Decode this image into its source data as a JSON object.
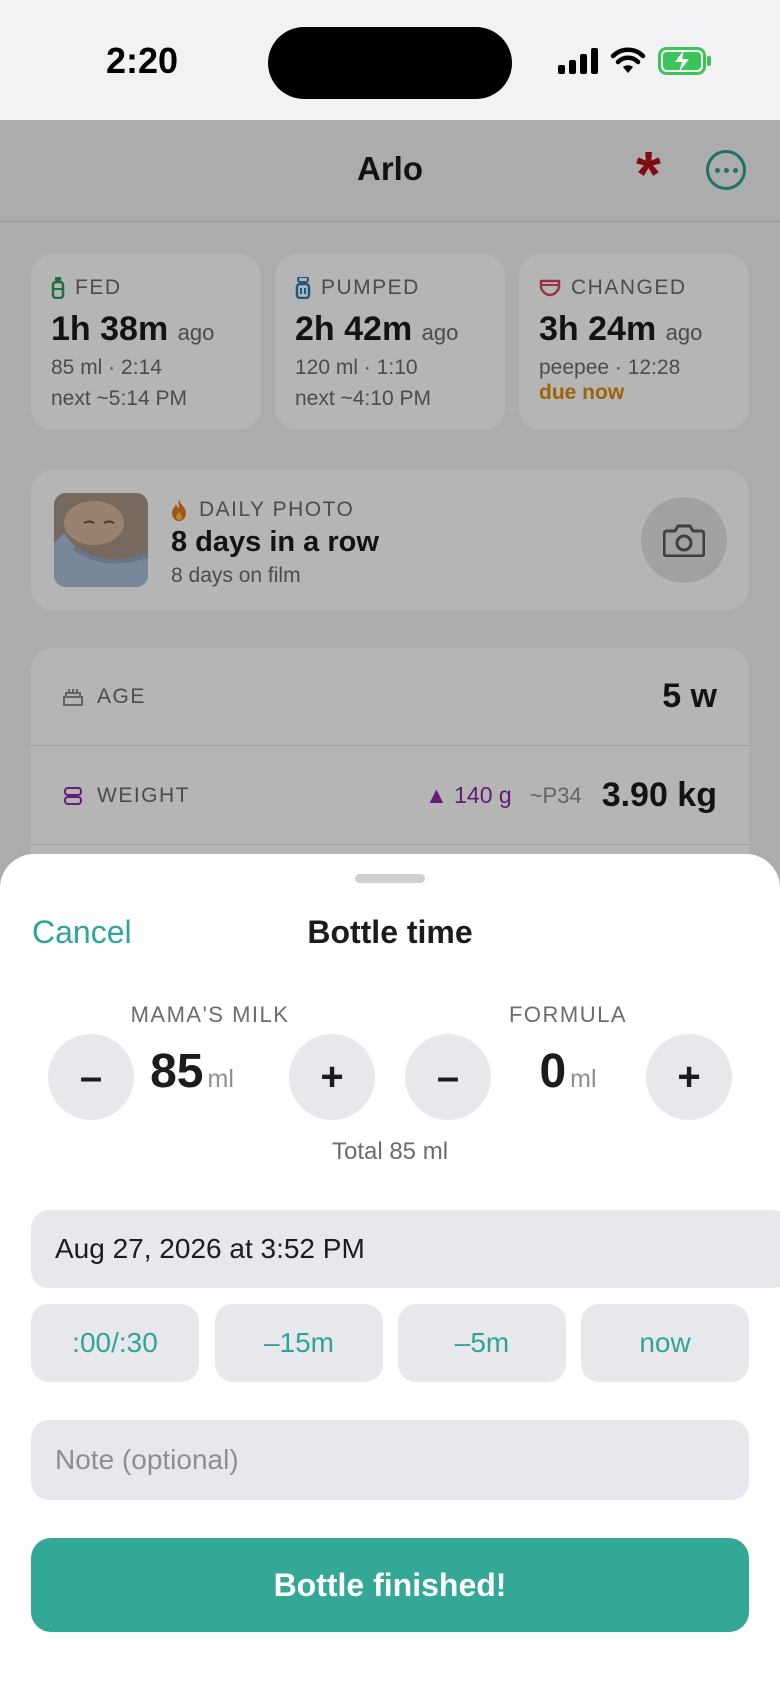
{
  "status_bar": {
    "time": "2:20"
  },
  "app": {
    "title": "Arlo",
    "stats": [
      {
        "label": "FED",
        "value": "1h 38m",
        "ago": "ago",
        "detail": "85 ml · 2:14",
        "next": "next ~5:14 PM"
      },
      {
        "label": "PUMPED",
        "value": "2h 42m",
        "ago": "ago",
        "detail": "120 ml · 1:10",
        "next": "next ~4:10 PM"
      },
      {
        "label": "CHANGED",
        "value": "3h 24m",
        "ago": "ago",
        "detail": "peepee · 12:28",
        "due": "due now"
      }
    ],
    "daily_photo": {
      "label": "DAILY PHOTO",
      "title": "8 days in a row",
      "subtitle": "8 days on film"
    },
    "info": {
      "age_label": "AGE",
      "age_value": "5 w",
      "weight_label": "WEIGHT",
      "weight_delta": "▲ 140 g",
      "weight_percentile": "~P34",
      "weight_value": "3.90 kg"
    }
  },
  "sheet": {
    "cancel": "Cancel",
    "title": "Bottle time",
    "mama": {
      "label": "MAMA'S MILK",
      "value": "85",
      "unit": "ml"
    },
    "formula": {
      "label": "FORMULA",
      "value": "0",
      "unit": "ml"
    },
    "minus": "–",
    "plus": "+",
    "total": "Total 85 ml",
    "datetime": "Aug 27, 2026 at 3:52 PM",
    "quick": [
      ":00/:30",
      "–15m",
      "–5m",
      "now"
    ],
    "note_placeholder": "Note (optional)",
    "submit": "Bottle finished!"
  }
}
